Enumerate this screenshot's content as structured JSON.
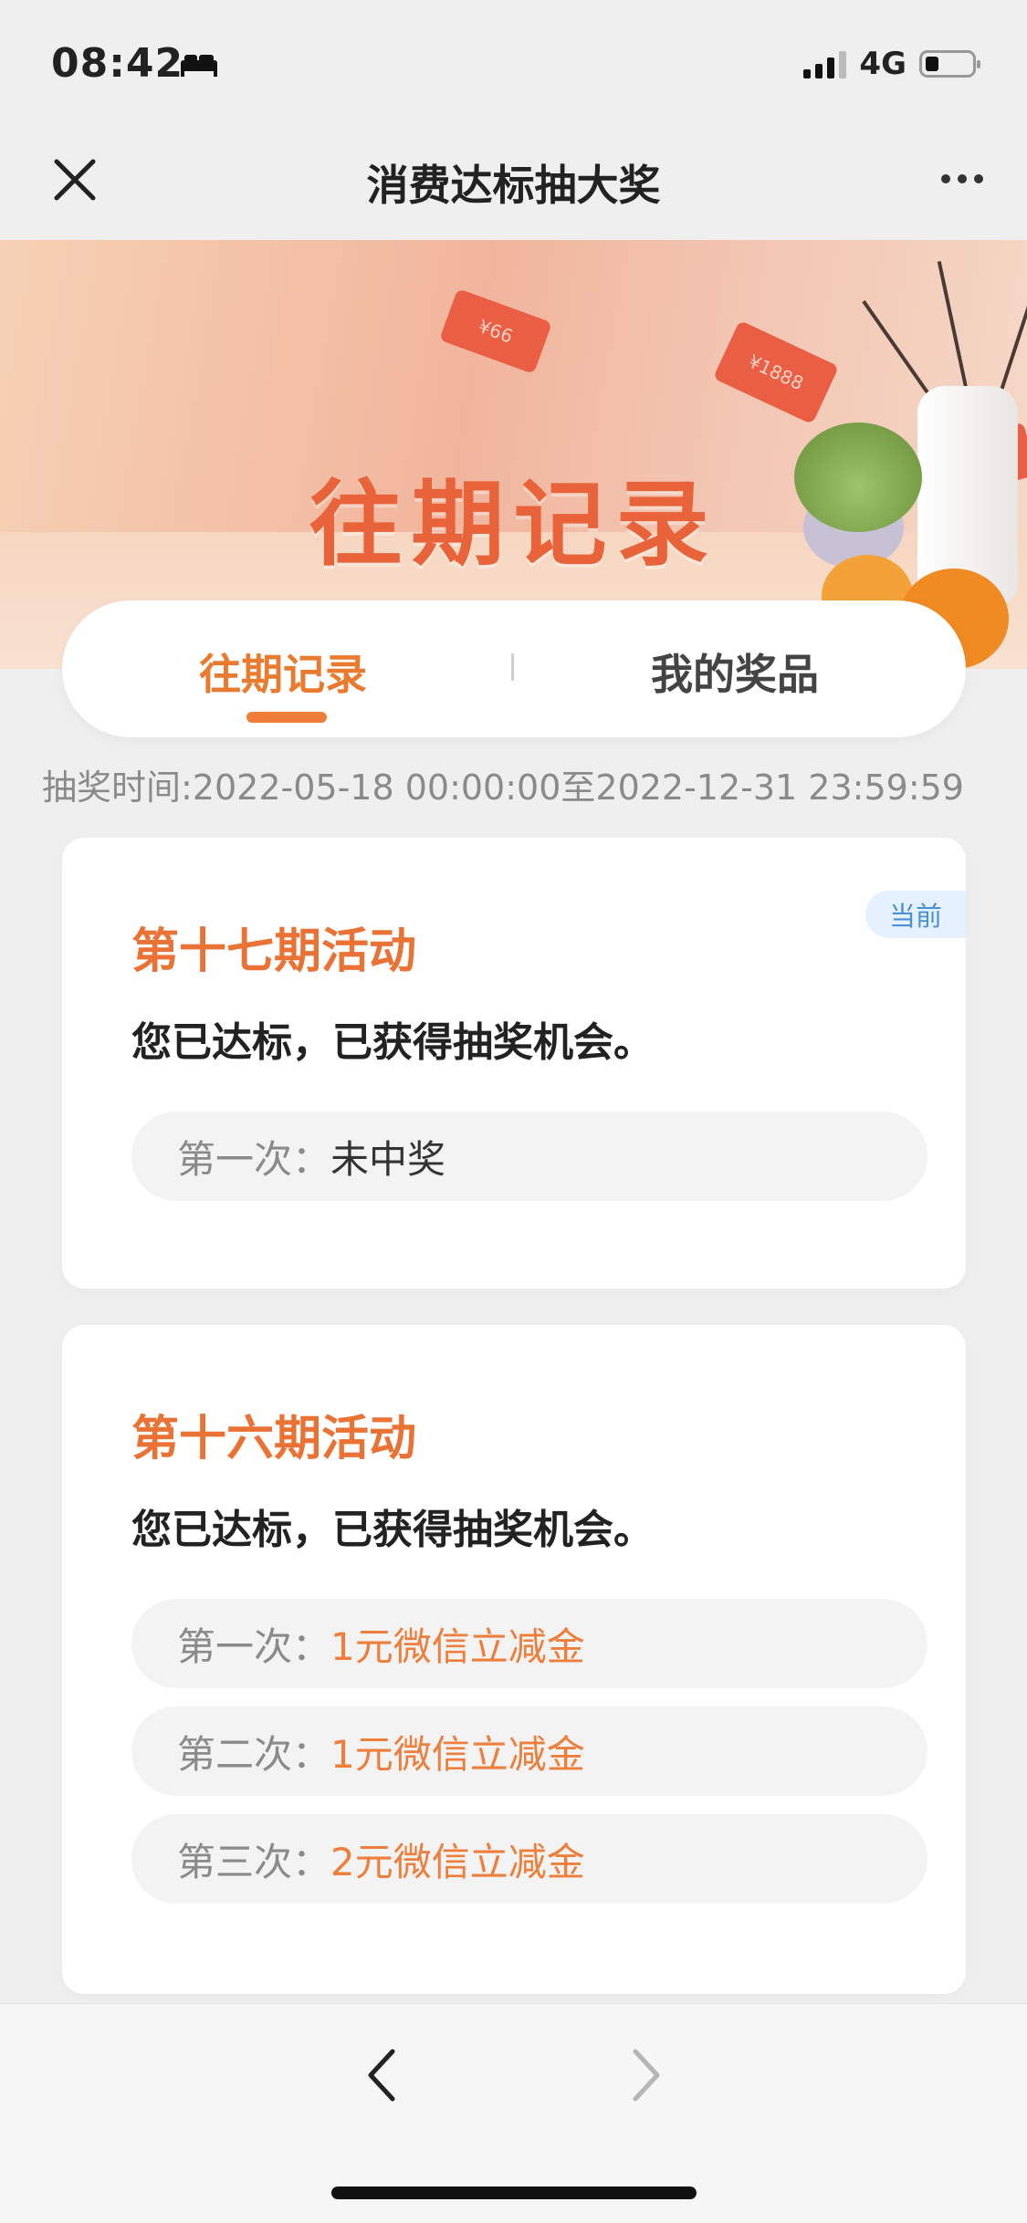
{
  "status_bar": {
    "time": "08:42",
    "network": "4G"
  },
  "navbar": {
    "title": "消费达标抽大奖"
  },
  "banner": {
    "title": "往期记录",
    "ticket_small": "¥66",
    "ticket_large": "¥1888"
  },
  "tabs": [
    {
      "label": "往期记录",
      "active": true
    },
    {
      "label": "我的奖品",
      "active": false
    }
  ],
  "lottery_time": "抽奖时间:2022-05-18 00:00:00至2022-12-31 23:59:59",
  "activities": [
    {
      "title": "第十七期活动",
      "badge": "当前",
      "status": "您已达标，已获得抽奖机会。",
      "draws": [
        {
          "label": "第一次：",
          "result": "未中奖",
          "won": false
        }
      ]
    },
    {
      "title": "第十六期活动",
      "status": "您已达标，已获得抽奖机会。",
      "draws": [
        {
          "label": "第一次：",
          "result": "1元微信立减金",
          "won": true
        },
        {
          "label": "第二次：",
          "result": "1元微信立减金",
          "won": true
        },
        {
          "label": "第三次：",
          "result": "2元微信立减金",
          "won": true
        }
      ]
    }
  ],
  "colors": {
    "accent": "#e97a2e",
    "badge_text": "#4a90d9",
    "badge_bg": "#e5f1fe",
    "background": "#efefef"
  }
}
